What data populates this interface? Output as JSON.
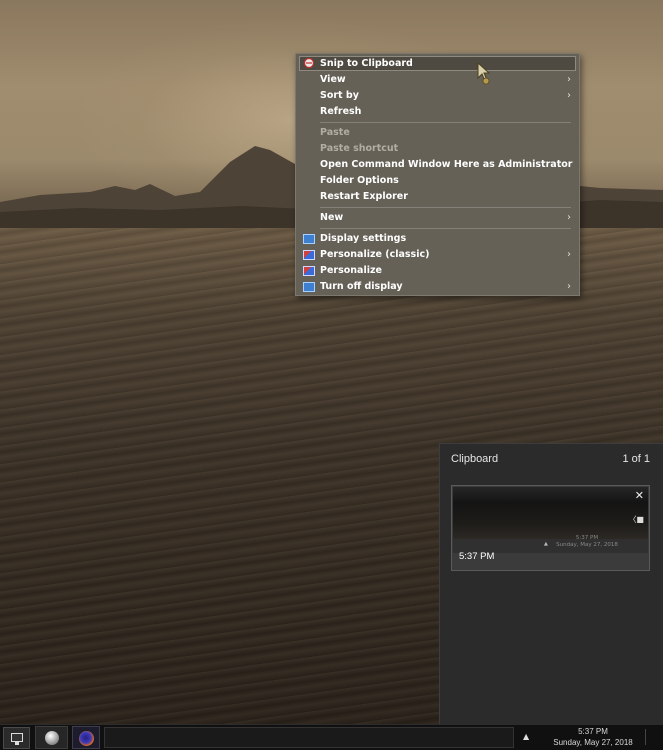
{
  "context_menu": {
    "items": [
      {
        "label": "Snip to Clipboard"
      },
      {
        "label": "View"
      },
      {
        "label": "Sort by"
      },
      {
        "label": "Refresh"
      },
      {
        "label": "Paste"
      },
      {
        "label": "Paste shortcut"
      },
      {
        "label": "Open Command Window Here as Administrator"
      },
      {
        "label": "Folder Options"
      },
      {
        "label": "Restart Explorer"
      },
      {
        "label": "New"
      },
      {
        "label": "Display settings"
      },
      {
        "label": "Personalize (classic)"
      },
      {
        "label": "Personalize"
      },
      {
        "label": "Turn off display"
      }
    ],
    "submenu_arrow": "›"
  },
  "clipboard_panel": {
    "title": "Clipboard",
    "count": "1 of 1",
    "item": {
      "close_glyph": "✕",
      "time": "5:37 PM",
      "thumb_time": "5:37 PM",
      "thumb_date": "Sunday, May 27, 2018"
    }
  },
  "taskbar": {
    "tray_arrow": "▲",
    "clock_time": "5:37 PM",
    "clock_date": "Sunday, May 27, 2018"
  },
  "colors": {
    "menu_bg": "#656157",
    "highlight_bg": "#4e4a42",
    "clipboard_bg": "#2b2b2b",
    "taskbar_bg": "#101010"
  }
}
